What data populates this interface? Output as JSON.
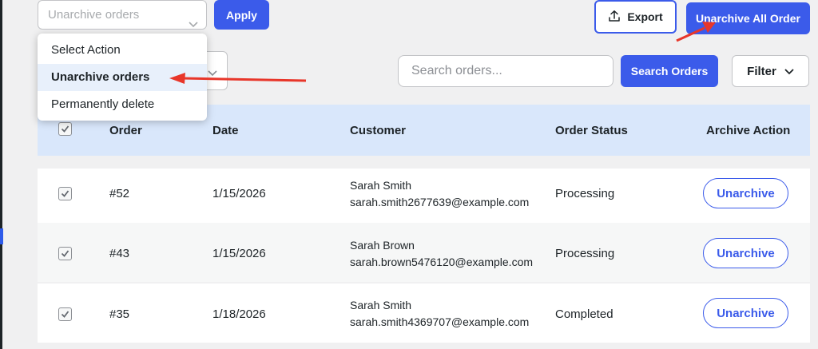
{
  "toolbar": {
    "bulk_select_value": "Unarchive orders",
    "apply_label": "Apply",
    "export_label": "Export",
    "unarchive_all_label": "Unarchive All Order"
  },
  "dropdown": {
    "items": [
      {
        "label": "Select Action"
      },
      {
        "label": "Unarchive orders",
        "active": true
      },
      {
        "label": "Permanently delete"
      }
    ]
  },
  "search": {
    "placeholder": "Search orders...",
    "button_label": "Search Orders",
    "filter_label": "Filter"
  },
  "table": {
    "columns": [
      "Order",
      "Date",
      "Customer",
      "Order Status",
      "Archive Action"
    ],
    "rows": [
      {
        "order": "#52",
        "date": "1/15/2026",
        "customer_name": "Sarah Smith",
        "customer_email": "sarah.smith2677639@example.com",
        "status": "Processing",
        "action": "Unarchive",
        "checked": true
      },
      {
        "order": "#43",
        "date": "1/15/2026",
        "customer_name": "Sarah Brown",
        "customer_email": "sarah.brown5476120@example.com",
        "status": "Processing",
        "action": "Unarchive",
        "checked": true
      },
      {
        "order": "#35",
        "date": "1/18/2026",
        "customer_name": "Sarah Smith",
        "customer_email": "sarah.smith4369707@example.com",
        "status": "Completed",
        "action": "Unarchive",
        "checked": true
      }
    ]
  },
  "colors": {
    "accent": "#3b5bea",
    "header_bg": "#d9e7fb",
    "annotation_arrow": "#e8362a"
  },
  "icons": {
    "chevron": "chevron-down-icon",
    "export": "upload-icon",
    "checkbox": "checkbox-checked-icon",
    "annotation": "red-arrow-icon"
  }
}
